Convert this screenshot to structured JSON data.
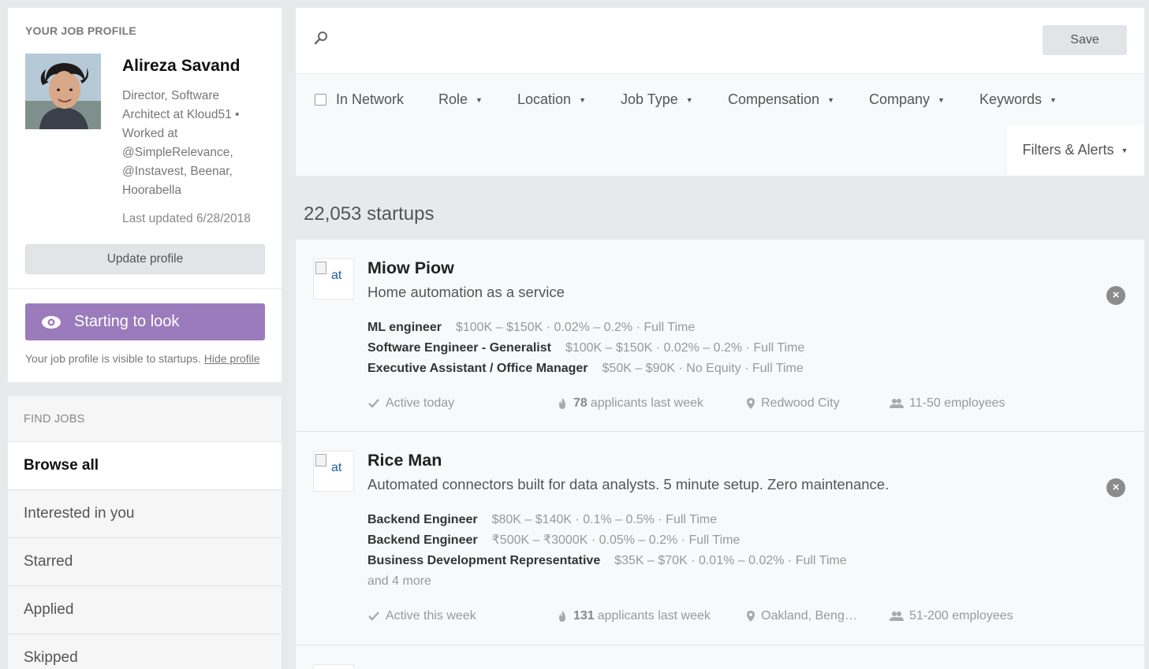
{
  "profile": {
    "section_label": "YOUR JOB PROFILE",
    "name": "Alireza Savand",
    "bio": "Director, Software Architect at Kloud51 • Worked at @SimpleRelevance, @Instavest, Beenar, Hoorabella",
    "last_updated": "Last updated 6/28/2018",
    "update_button": "Update profile",
    "status_button": "Starting to look",
    "visibility_note": "Your job profile is visible to startups.",
    "hide_link": "Hide profile"
  },
  "find_jobs": {
    "section_label": "FIND JOBS",
    "items": [
      {
        "label": "Browse all",
        "active": true
      },
      {
        "label": "Interested in you",
        "active": false
      },
      {
        "label": "Starred",
        "active": false
      },
      {
        "label": "Applied",
        "active": false
      },
      {
        "label": "Skipped",
        "active": false
      }
    ]
  },
  "search": {
    "placeholder": "",
    "save_label": "Save",
    "icon": "search-icon"
  },
  "filters": {
    "in_network": "In Network",
    "role": "Role",
    "location": "Location",
    "job_type": "Job Type",
    "compensation": "Compensation",
    "company": "Company",
    "keywords": "Keywords",
    "filters_alerts": "Filters & Alerts"
  },
  "results": {
    "count": "22,053 startups"
  },
  "startups": [
    {
      "name": "Miow Piow",
      "pitch": "Home automation as a service",
      "logo_alt": "at",
      "jobs": [
        {
          "title": "ML engineer",
          "details": "$100K – $150K · 0.02% – 0.2% · Full Time"
        },
        {
          "title": "Software Engineer - Generalist",
          "details": "$100K – $150K · 0.02% – 0.2% · Full Time"
        },
        {
          "title": "Executive Assistant / Office Manager",
          "details": "$50K – $90K · No Equity · Full Time"
        }
      ],
      "more": "",
      "activity": "Active today",
      "applicants_count": "78",
      "applicants_label": "applicants last week",
      "location": "Redwood City",
      "size": "11-50 employees"
    },
    {
      "name": "Rice Man",
      "pitch": "Automated connectors built for data analysts. 5 minute setup. Zero maintenance.",
      "logo_alt": "at",
      "jobs": [
        {
          "title": "Backend Engineer",
          "details": "$80K – $140K · 0.1% – 0.5% · Full Time"
        },
        {
          "title": "Backend Engineer",
          "details": "₹500K – ₹3000K · 0.05% – 0.2% · Full Time"
        },
        {
          "title": "Business Development Representative",
          "details": "$35K – $70K · 0.01% – 0.02% · Full Time"
        }
      ],
      "more": "and 4 more",
      "activity": "Active this week",
      "applicants_count": "131",
      "applicants_label": "applicants last week",
      "location": "Oakland, Beng…",
      "size": "51-200 employees"
    }
  ],
  "colors": {
    "accent_purple": "#9b7bbb",
    "background": "#e8e9eb"
  }
}
